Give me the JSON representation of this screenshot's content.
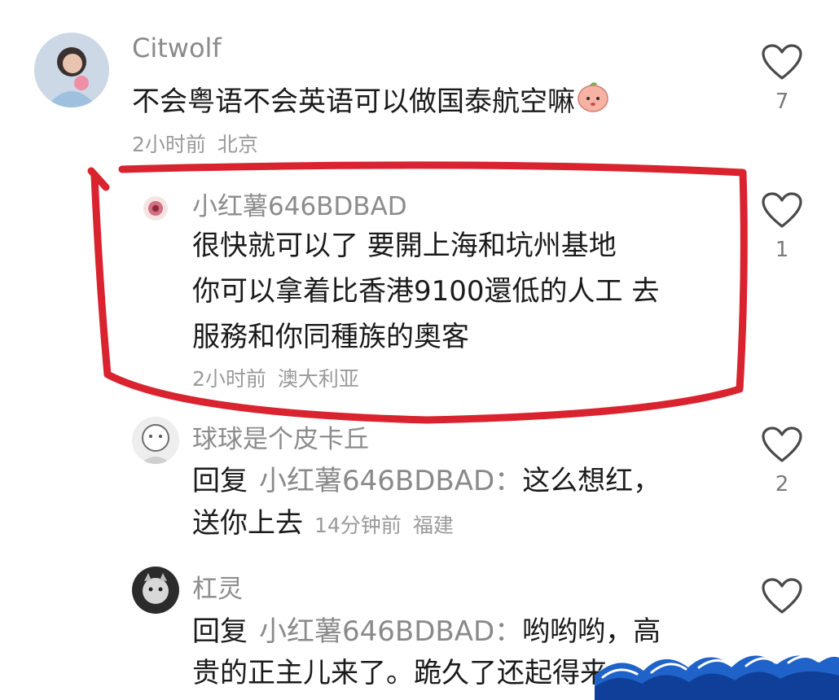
{
  "comments": [
    {
      "username": "Citwolf",
      "text": "不会粤语不会英语可以做国泰航空嘛",
      "emoji": "peach-emoji",
      "time": "2小时前",
      "location": "北京",
      "likes": "7"
    },
    {
      "username": "小红薯646BDBAD",
      "lines": [
        "很快就可以了 要開上海和坑州基地",
        "你可以拿着比香港9100還低的人工 去",
        "服務和你同種族的奧客"
      ],
      "time": "2小时前",
      "location": "澳大利亚",
      "likes": "1"
    },
    {
      "username": "球球是个皮卡丘",
      "reply_prefix": "回复",
      "mention": "小红薯646BDBAD：",
      "line1_text": "这么想红，",
      "line2_text": "送你上去",
      "time": "14分钟前",
      "location": "福建",
      "likes": "2"
    },
    {
      "username": "杠灵",
      "reply_prefix": "回复",
      "mention": "小红薯646BDBAD：",
      "line1_text": "哟哟哟，高",
      "line2_text": "贵的正主儿来了。跪久了还起得来"
    }
  ],
  "colors": {
    "highlight": "#d9232f",
    "text": "#1a1a1a",
    "muted": "#9a9a9a"
  }
}
